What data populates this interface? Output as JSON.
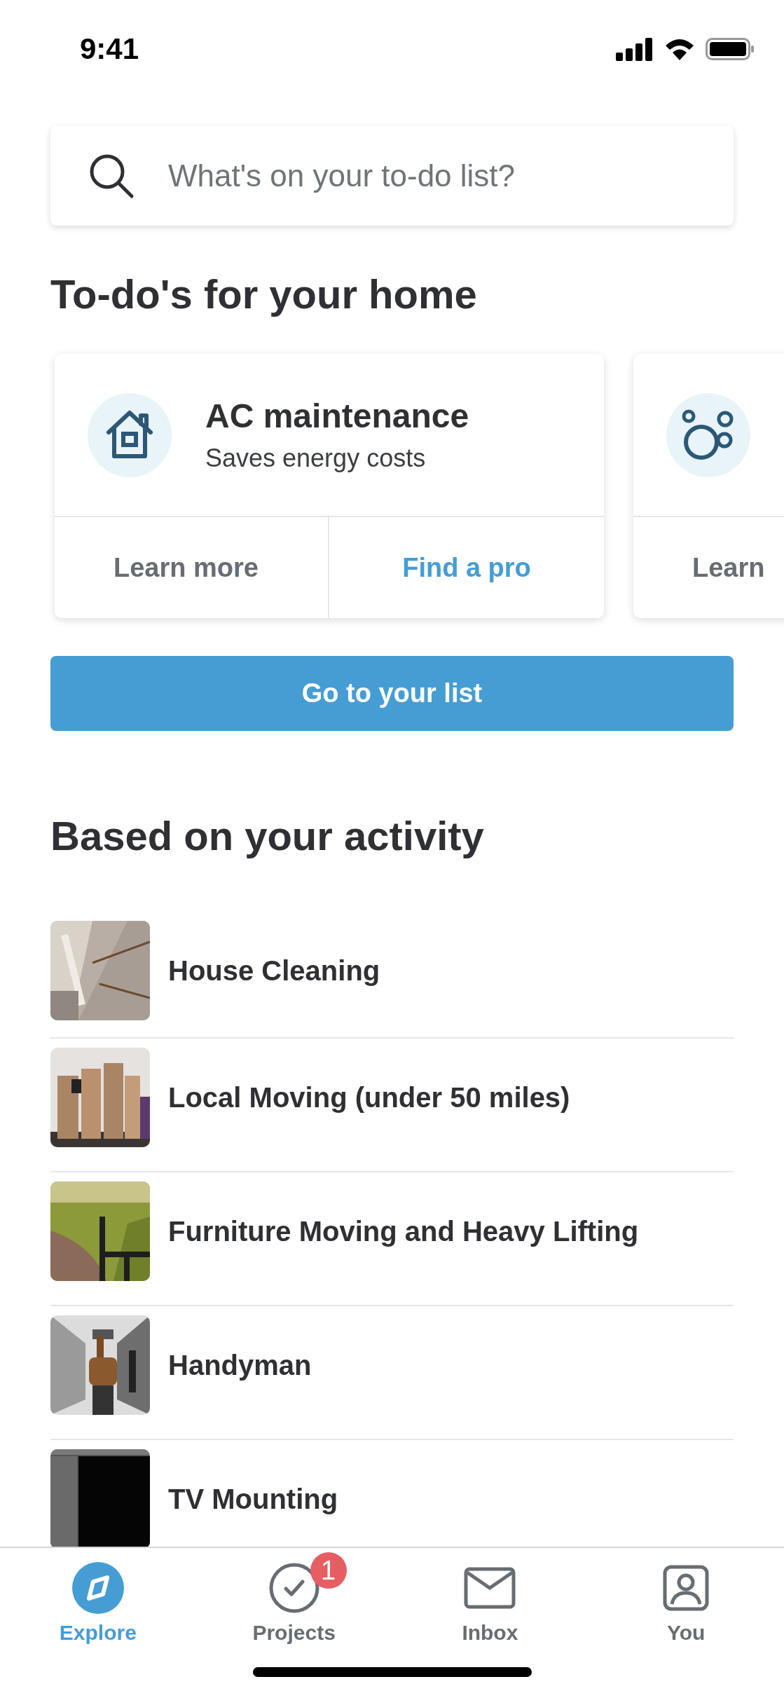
{
  "status_bar": {
    "time": "9:41"
  },
  "search": {
    "placeholder": "What's on your to-do list?"
  },
  "todos": {
    "title": "To-do's for your home",
    "cards": [
      {
        "title": "AC maintenance",
        "subtitle": "Saves energy costs",
        "actions": [
          {
            "label": "Learn more",
            "kind": "secondary"
          },
          {
            "label": "Find a pro",
            "kind": "primary"
          }
        ]
      },
      {
        "actions": [
          {
            "label": "Learn",
            "kind": "secondary"
          }
        ]
      }
    ]
  },
  "list_button": {
    "label": "Go to your list"
  },
  "activity": {
    "title": "Based on your activity",
    "items": [
      {
        "label": "House Cleaning"
      },
      {
        "label": "Local Moving (under 50 miles)"
      },
      {
        "label": "Furniture Moving and Heavy Lifting"
      },
      {
        "label": "Handyman"
      },
      {
        "label": "TV Mounting"
      }
    ]
  },
  "tab_bar": [
    {
      "label": "Explore",
      "selected": true
    },
    {
      "label": "Projects",
      "selected": false,
      "badge": "1"
    },
    {
      "label": "Inbox",
      "selected": false
    },
    {
      "label": "You",
      "selected": false
    }
  ]
}
